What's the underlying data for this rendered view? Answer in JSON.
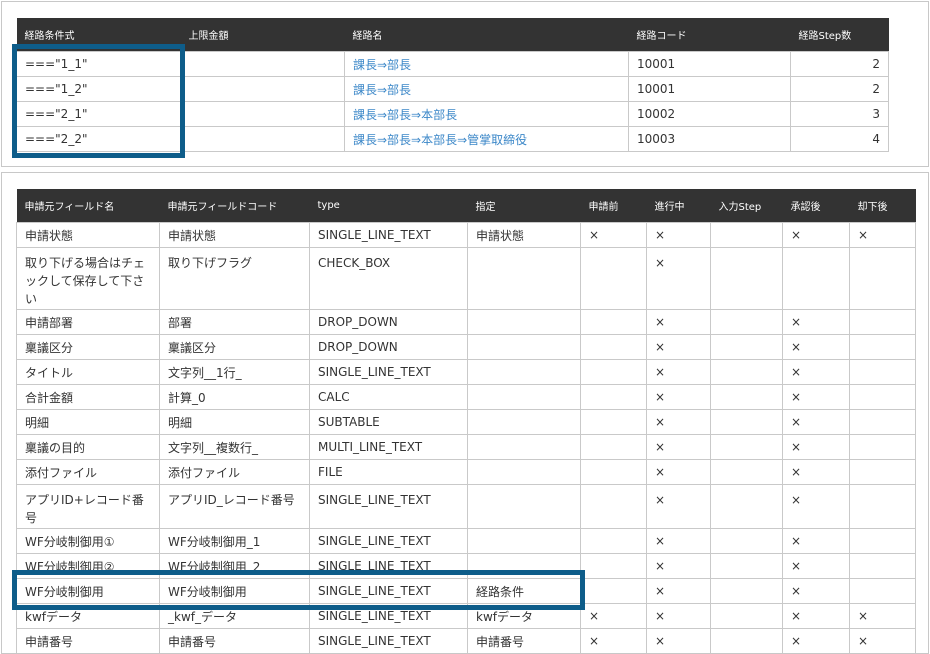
{
  "route_table": {
    "headers": [
      "経路条件式",
      "上限金額",
      "経路名",
      "経路コード",
      "経路Step数"
    ],
    "rows": [
      {
        "condition": "===\"1_1\"",
        "limit": "",
        "route_name": "課長⇒部長",
        "route_code": "10001",
        "steps": "2"
      },
      {
        "condition": "===\"1_2\"",
        "limit": "",
        "route_name": "課長⇒部長",
        "route_code": "10001",
        "steps": "2"
      },
      {
        "condition": "===\"2_1\"",
        "limit": "",
        "route_name": "課長⇒部長⇒本部長",
        "route_code": "10002",
        "steps": "3"
      },
      {
        "condition": "===\"2_2\"",
        "limit": "",
        "route_name": "課長⇒部長⇒本部長⇒管掌取締役",
        "route_code": "10003",
        "steps": "4"
      }
    ]
  },
  "field_table": {
    "headers": [
      "申請元フィールド名",
      "申請元フィールドコード",
      "type",
      "指定",
      "申請前",
      "進行中",
      "入力Step",
      "承認後",
      "却下後"
    ],
    "mark": "×",
    "rows": [
      {
        "name": "申請状態",
        "code": "申請状態",
        "type": "SINGLE_LINE_TEXT",
        "spec": "申請状態",
        "before": "×",
        "progress": "×",
        "input_step": "",
        "approved": "×",
        "rejected": "×"
      },
      {
        "name": "取り下げる場合はチェックして保存して下さい",
        "code": "取り下げフラグ",
        "type": "CHECK_BOX",
        "spec": "",
        "before": "",
        "progress": "×",
        "input_step": "",
        "approved": "",
        "rejected": ""
      },
      {
        "name": "申請部署",
        "code": "部署",
        "type": "DROP_DOWN",
        "spec": "",
        "before": "",
        "progress": "×",
        "input_step": "",
        "approved": "×",
        "rejected": ""
      },
      {
        "name": "稟議区分",
        "code": "稟議区分",
        "type": "DROP_DOWN",
        "spec": "",
        "before": "",
        "progress": "×",
        "input_step": "",
        "approved": "×",
        "rejected": ""
      },
      {
        "name": "タイトル",
        "code": "文字列__1行_",
        "type": "SINGLE_LINE_TEXT",
        "spec": "",
        "before": "",
        "progress": "×",
        "input_step": "",
        "approved": "×",
        "rejected": ""
      },
      {
        "name": "合計金額",
        "code": "計算_0",
        "type": "CALC",
        "spec": "",
        "before": "",
        "progress": "×",
        "input_step": "",
        "approved": "×",
        "rejected": ""
      },
      {
        "name": "明細",
        "code": "明細",
        "type": "SUBTABLE",
        "spec": "",
        "before": "",
        "progress": "×",
        "input_step": "",
        "approved": "×",
        "rejected": ""
      },
      {
        "name": "稟議の目的",
        "code": "文字列__複数行_",
        "type": "MULTI_LINE_TEXT",
        "spec": "",
        "before": "",
        "progress": "×",
        "input_step": "",
        "approved": "×",
        "rejected": ""
      },
      {
        "name": "添付ファイル",
        "code": "添付ファイル",
        "type": "FILE",
        "spec": "",
        "before": "",
        "progress": "×",
        "input_step": "",
        "approved": "×",
        "rejected": ""
      },
      {
        "name": "アプリID+レコード番号",
        "code": "アプリID_レコード番号",
        "type": "SINGLE_LINE_TEXT",
        "spec": "",
        "before": "",
        "progress": "×",
        "input_step": "",
        "approved": "×",
        "rejected": ""
      },
      {
        "name": "WF分岐制御用①",
        "code": "WF分岐制御用_1",
        "type": "SINGLE_LINE_TEXT",
        "spec": "",
        "before": "",
        "progress": "×",
        "input_step": "",
        "approved": "×",
        "rejected": ""
      },
      {
        "name": "WF分岐制御用②",
        "code": "WF分岐制御用_2",
        "type": "SINGLE_LINE_TEXT",
        "spec": "",
        "before": "",
        "progress": "×",
        "input_step": "",
        "approved": "×",
        "rejected": ""
      },
      {
        "name": "WF分岐制御用",
        "code": "WF分岐制御用",
        "type": "SINGLE_LINE_TEXT",
        "spec": "経路条件",
        "before": "",
        "progress": "×",
        "input_step": "",
        "approved": "×",
        "rejected": ""
      },
      {
        "name": "kwfデータ",
        "code": "_kwf_データ",
        "type": "SINGLE_LINE_TEXT",
        "spec": "kwfデータ",
        "before": "×",
        "progress": "×",
        "input_step": "",
        "approved": "×",
        "rejected": "×"
      },
      {
        "name": "申請番号",
        "code": "申請番号",
        "type": "SINGLE_LINE_TEXT",
        "spec": "申請番号",
        "before": "×",
        "progress": "×",
        "input_step": "",
        "approved": "×",
        "rejected": "×"
      }
    ]
  },
  "highlight_color": "#0e5d8a"
}
